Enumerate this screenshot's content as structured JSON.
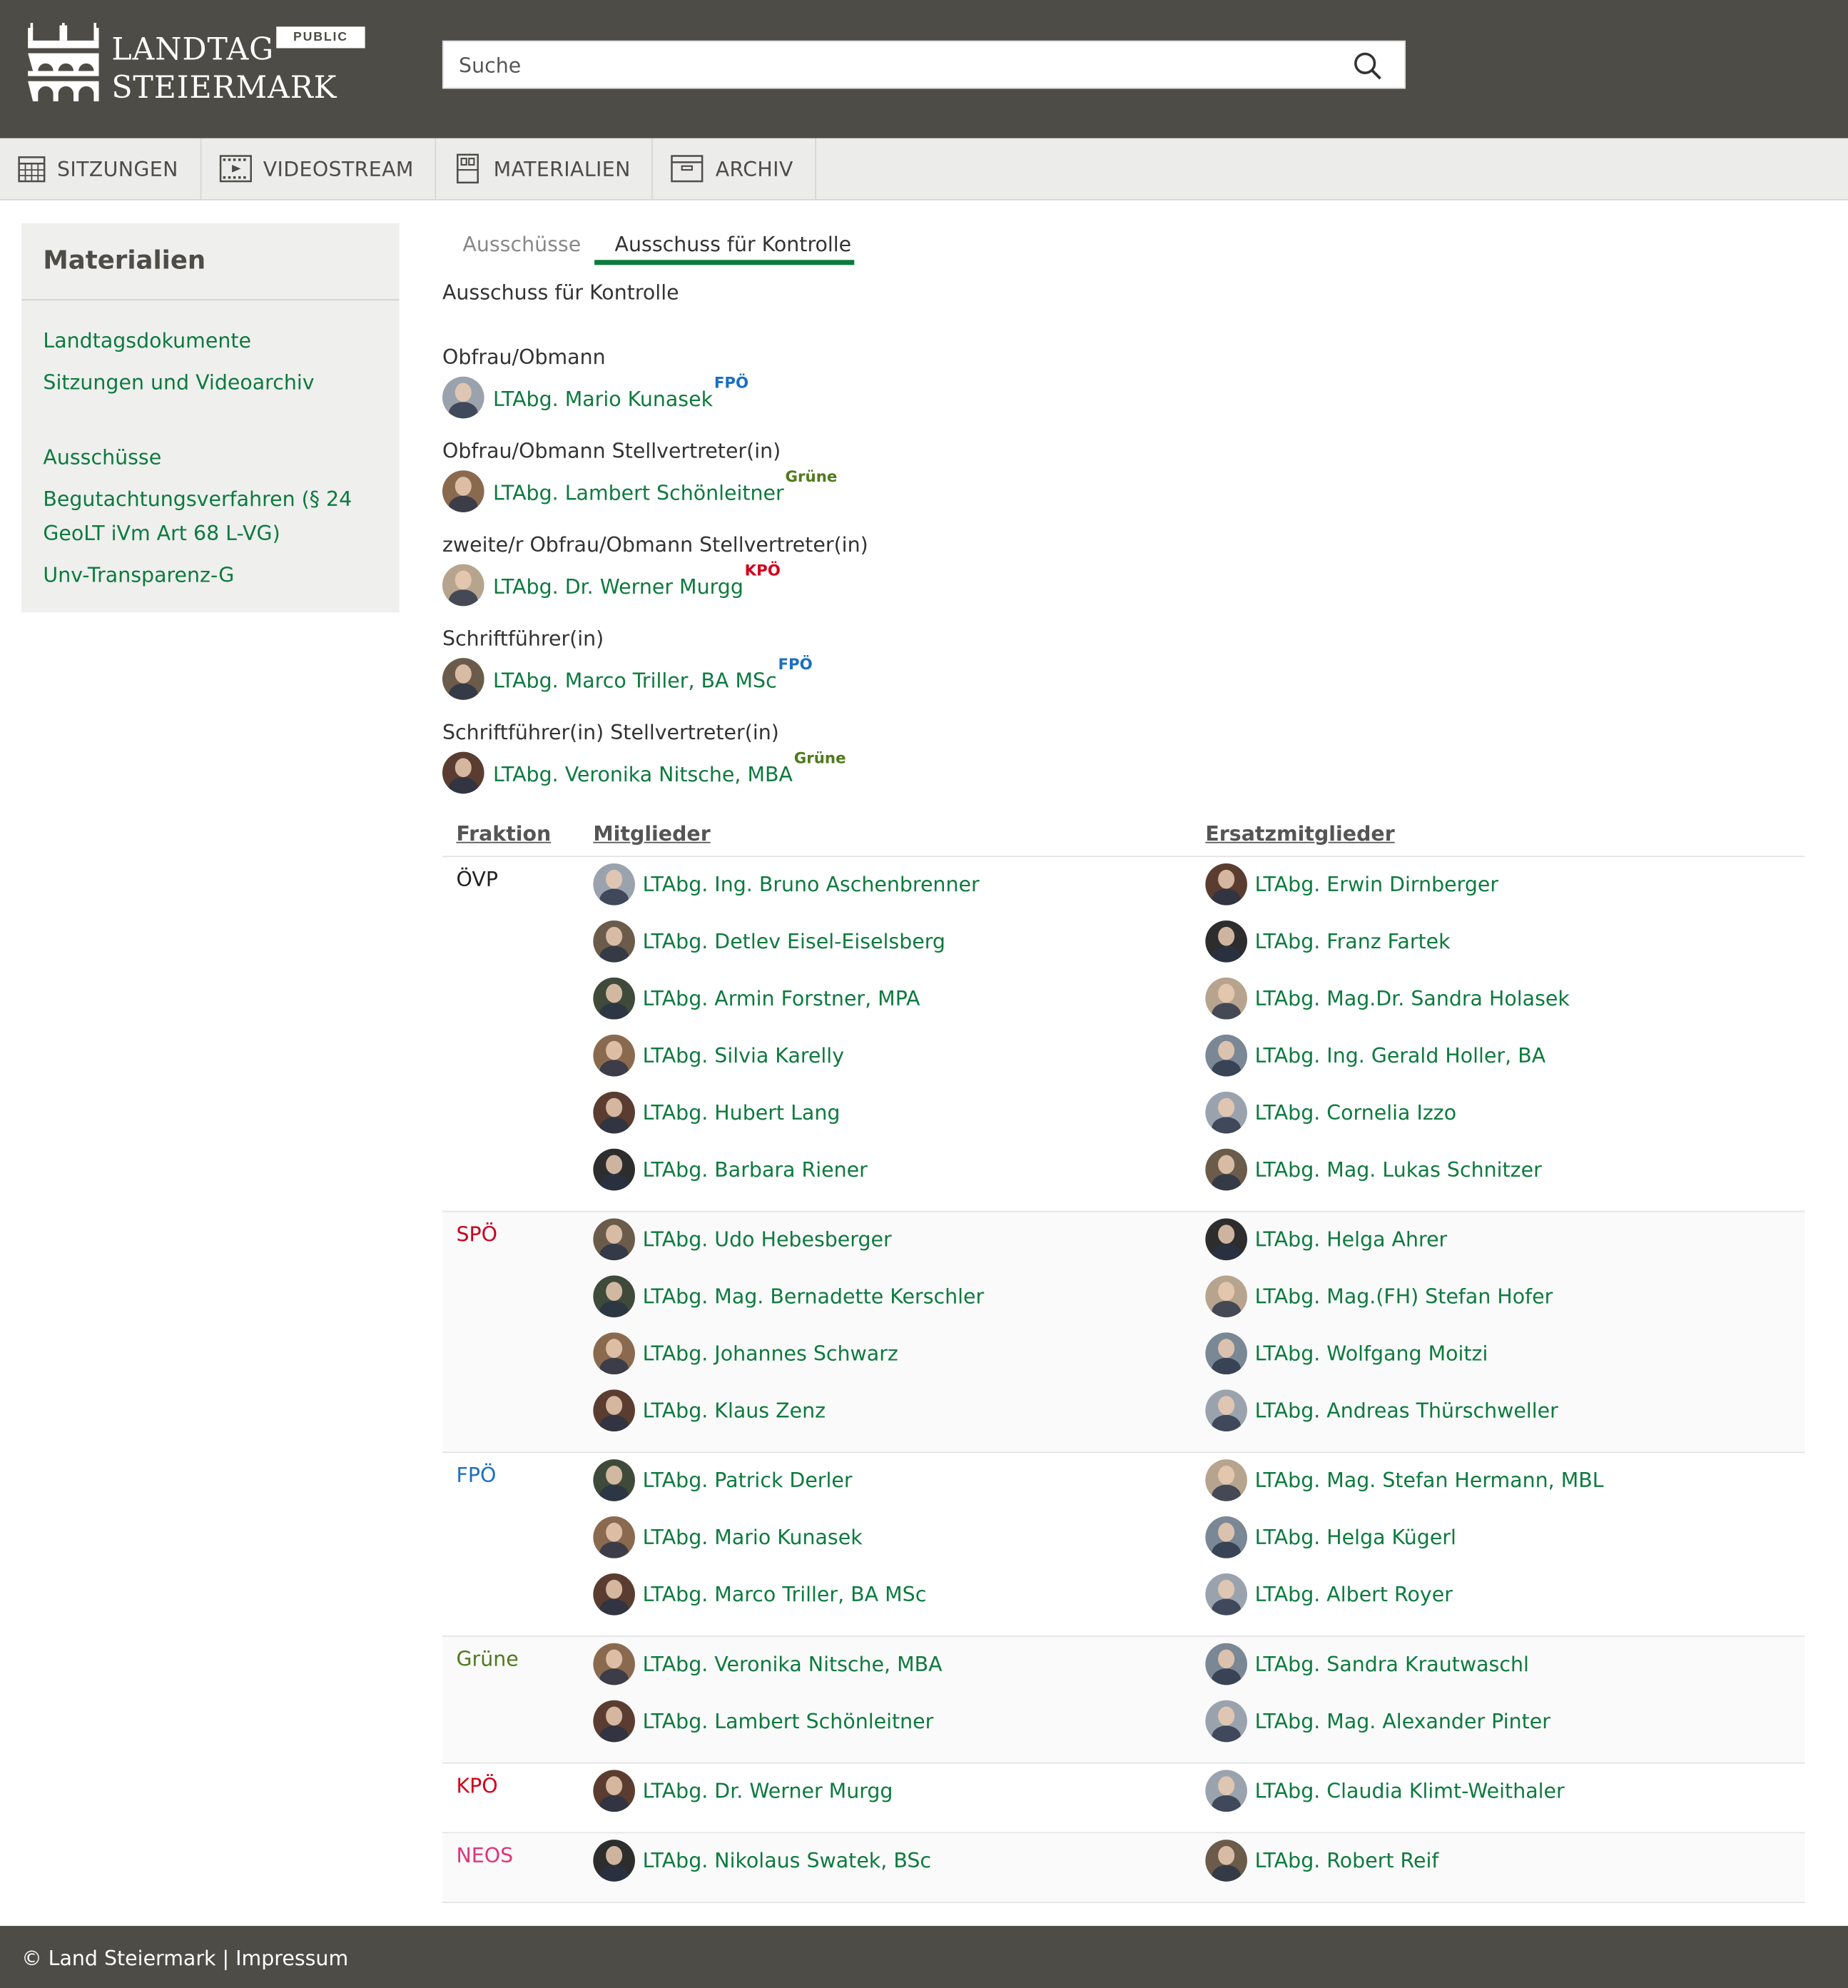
{
  "header": {
    "logo_line1": "LANDTAG",
    "logo_line2": "STEIERMARK",
    "badge": "PUBLIC",
    "search_placeholder": "Suche"
  },
  "nav": [
    {
      "label": "SITZUNGEN",
      "icon": "calendar-icon"
    },
    {
      "label": "VIDEOSTREAM",
      "icon": "film-icon"
    },
    {
      "label": "MATERIALIEN",
      "icon": "documents-icon"
    },
    {
      "label": "ARCHIV",
      "icon": "archive-box-icon"
    }
  ],
  "sidebar": {
    "title": "Materialien",
    "links": [
      "Landtagsdokumente",
      "Sitzungen und Videoarchiv",
      "Ausschüsse",
      "Begutachtungsverfahren (§ 24",
      "GeoLT iVm Art 68 L-VG)",
      "Unv-Transparenz-G"
    ]
  },
  "tabs": [
    "Ausschüsse",
    "Ausschuss für Kontrolle"
  ],
  "heading": "Ausschuss für Kontrolle",
  "roles": [
    {
      "label": "Obfrau/Obmann",
      "name": "LTAbg. Mario Kunasek",
      "party": "FPÖ"
    },
    {
      "label": "Obfrau/Obmann Stellvertreter(in)",
      "name": "LTAbg. Lambert Schönleitner",
      "party": "Grüne"
    },
    {
      "label": "zweite/r Obfrau/Obmann Stellvertreter(in)",
      "name": "LTAbg. Dr. Werner Murgg",
      "party": "KPÖ"
    },
    {
      "label": "Schriftführer(in)",
      "name": "LTAbg. Marco Triller, BA MSc",
      "party": "FPÖ"
    },
    {
      "label": "Schriftführer(in) Stellvertreter(in)",
      "name": "LTAbg. Veronika Nitsche, MBA",
      "party": "Grüne"
    }
  ],
  "table": {
    "headers": {
      "fraktion": "Fraktion",
      "mitglieder": "Mitglieder",
      "ersatz": "Ersatzmitglieder"
    },
    "groups": [
      {
        "fraktion": "ÖVP",
        "mitglieder": [
          "LTAbg. Ing. Bruno Aschenbrenner",
          "LTAbg. Detlev Eisel-Eiselsberg",
          "LTAbg. Armin Forstner, MPA",
          "LTAbg. Silvia Karelly",
          "LTAbg. Hubert Lang",
          "LTAbg. Barbara Riener"
        ],
        "ersatz": [
          "LTAbg. Erwin Dirnberger",
          "LTAbg. Franz Fartek",
          "LTAbg. Mag.Dr. Sandra Holasek",
          "LTAbg. Ing. Gerald Holler, BA",
          "LTAbg. Cornelia Izzo",
          "LTAbg. Mag. Lukas Schnitzer"
        ]
      },
      {
        "fraktion": "SPÖ",
        "mitglieder": [
          "LTAbg. Udo Hebesberger",
          "LTAbg. Mag. Bernadette Kerschler",
          "LTAbg. Johannes Schwarz",
          "LTAbg. Klaus Zenz"
        ],
        "ersatz": [
          "LTAbg. Helga Ahrer",
          "LTAbg. Mag.(FH) Stefan Hofer",
          "LTAbg. Wolfgang Moitzi",
          "LTAbg. Andreas Thürschweller"
        ]
      },
      {
        "fraktion": "FPÖ",
        "mitglieder": [
          "LTAbg. Patrick Derler",
          "LTAbg. Mario Kunasek",
          "LTAbg. Marco Triller, BA MSc"
        ],
        "ersatz": [
          "LTAbg. Mag. Stefan Hermann, MBL",
          "LTAbg. Helga Kügerl",
          "LTAbg. Albert Royer"
        ]
      },
      {
        "fraktion": "Grüne",
        "mitglieder": [
          "LTAbg. Veronika Nitsche, MBA",
          "LTAbg. Lambert Schönleitner"
        ],
        "ersatz": [
          "LTAbg. Sandra Krautwaschl",
          "LTAbg. Mag. Alexander Pinter"
        ]
      },
      {
        "fraktion": "KPÖ",
        "mitglieder": [
          "LTAbg. Dr. Werner Murgg"
        ],
        "ersatz": [
          "LTAbg. Claudia Klimt-Weithaler"
        ]
      },
      {
        "fraktion": "NEOS",
        "mitglieder": [
          "LTAbg. Nikolaus Swatek, BSc"
        ],
        "ersatz": [
          "LTAbg. Robert Reif"
        ]
      }
    ]
  },
  "footer": {
    "copyright": "© Land Steiermark",
    "separator": "|",
    "impressum": "Impressum"
  },
  "colors": {
    "brand_green": "#0d7a3e",
    "header_bg": "#4e4c46",
    "FPÖ": "#1b6fc0",
    "Grüne": "#4f7a1c",
    "KPÖ": "#d0021b",
    "SPÖ": "#c8001e",
    "NEOS": "#e0347a",
    "ÖVP": "#222222"
  }
}
